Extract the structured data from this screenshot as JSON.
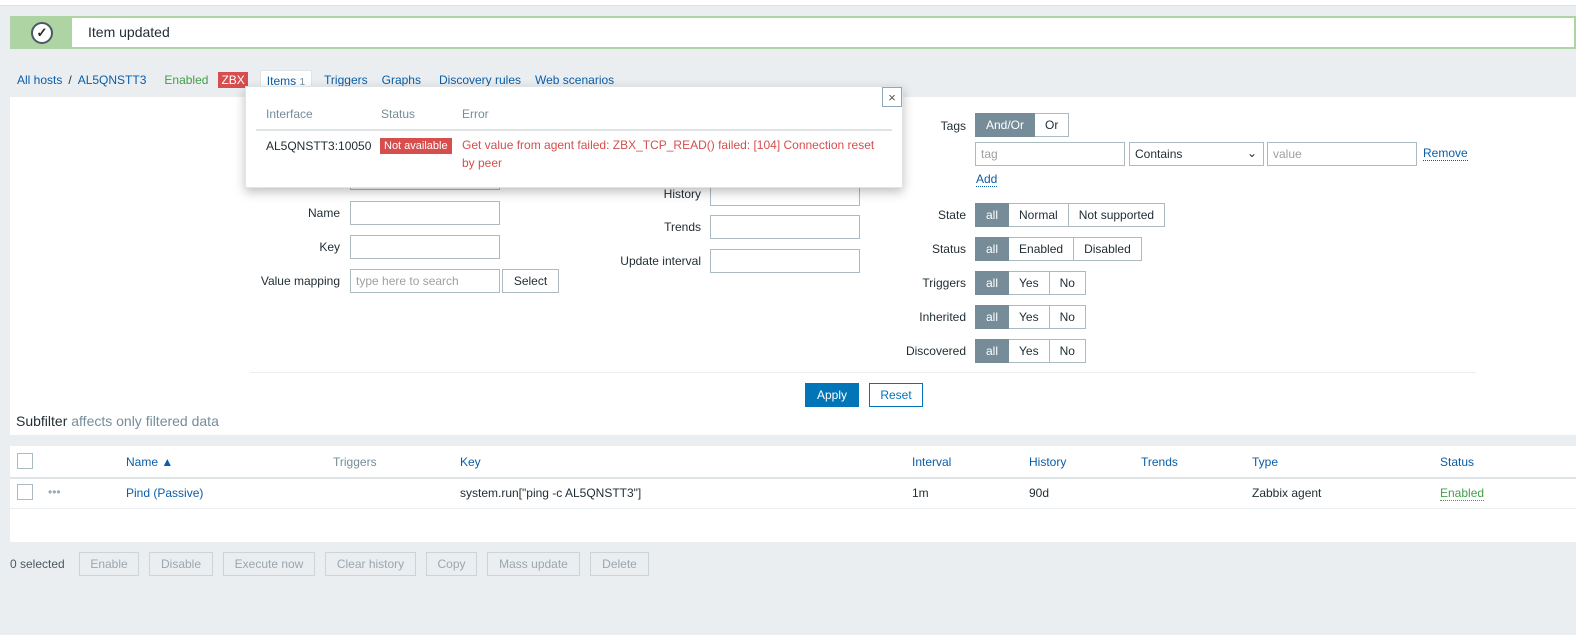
{
  "message": {
    "text": "Item updated",
    "icon": "check-circle-icon"
  },
  "nav": {
    "breadcrumb_all": "All hosts",
    "separator": "/",
    "host": "AL5QNSTT3",
    "status": "Enabled",
    "zbx": "ZBX",
    "items": "Items",
    "items_count": "1",
    "triggers": "Triggers",
    "graphs": "Graphs",
    "discovery": "Discovery rules",
    "web": "Web scenarios"
  },
  "popup": {
    "headers": [
      "Interface",
      "Status",
      "Error"
    ],
    "interface": "AL5QNSTT3:10050",
    "status": "Not available",
    "error": "Get value from agent failed: ZBX_TCP_READ() failed: [104] Connection reset by peer",
    "close": "×"
  },
  "filter": {
    "name_label": "Name",
    "key_label": "Key",
    "value_mapping_label": "Value mapping",
    "value_mapping_placeholder": "type here to search",
    "select": "Select",
    "history_label": "History",
    "trends_label": "Trends",
    "update_interval_label": "Update interval",
    "tags_label": "Tags",
    "tags_andor": "And/Or",
    "tags_or": "Or",
    "tag_placeholder": "tag",
    "tag_operator": "Contains",
    "value_placeholder": "value",
    "remove": "Remove",
    "add": "Add",
    "state_label": "State",
    "state": [
      "all",
      "Normal",
      "Not supported"
    ],
    "status_label": "Status",
    "status": [
      "all",
      "Enabled",
      "Disabled"
    ],
    "triggers_label": "Triggers",
    "triggers": [
      "all",
      "Yes",
      "No"
    ],
    "inherited_label": "Inherited",
    "inherited": [
      "all",
      "Yes",
      "No"
    ],
    "discovered_label": "Discovered",
    "discovered": [
      "all",
      "Yes",
      "No"
    ],
    "apply": "Apply",
    "reset": "Reset"
  },
  "subfilter": {
    "title": "Subfilter",
    "note": "affects only filtered data"
  },
  "table": {
    "headers": {
      "name": "Name ▲",
      "triggers": "Triggers",
      "key": "Key",
      "interval": "Interval",
      "history": "History",
      "trends": "Trends",
      "type": "Type",
      "status": "Status"
    },
    "rows": [
      {
        "name": "Pind (Passive)",
        "key": "system.run[\"ping -c AL5QNSTT3\"]",
        "interval": "1m",
        "history": "90d",
        "trends": "",
        "type": "Zabbix agent",
        "status": "Enabled"
      }
    ]
  },
  "footer": {
    "selected": "0 selected",
    "buttons": [
      "Enable",
      "Disable",
      "Execute now",
      "Clear history",
      "Copy",
      "Mass update",
      "Delete"
    ]
  }
}
